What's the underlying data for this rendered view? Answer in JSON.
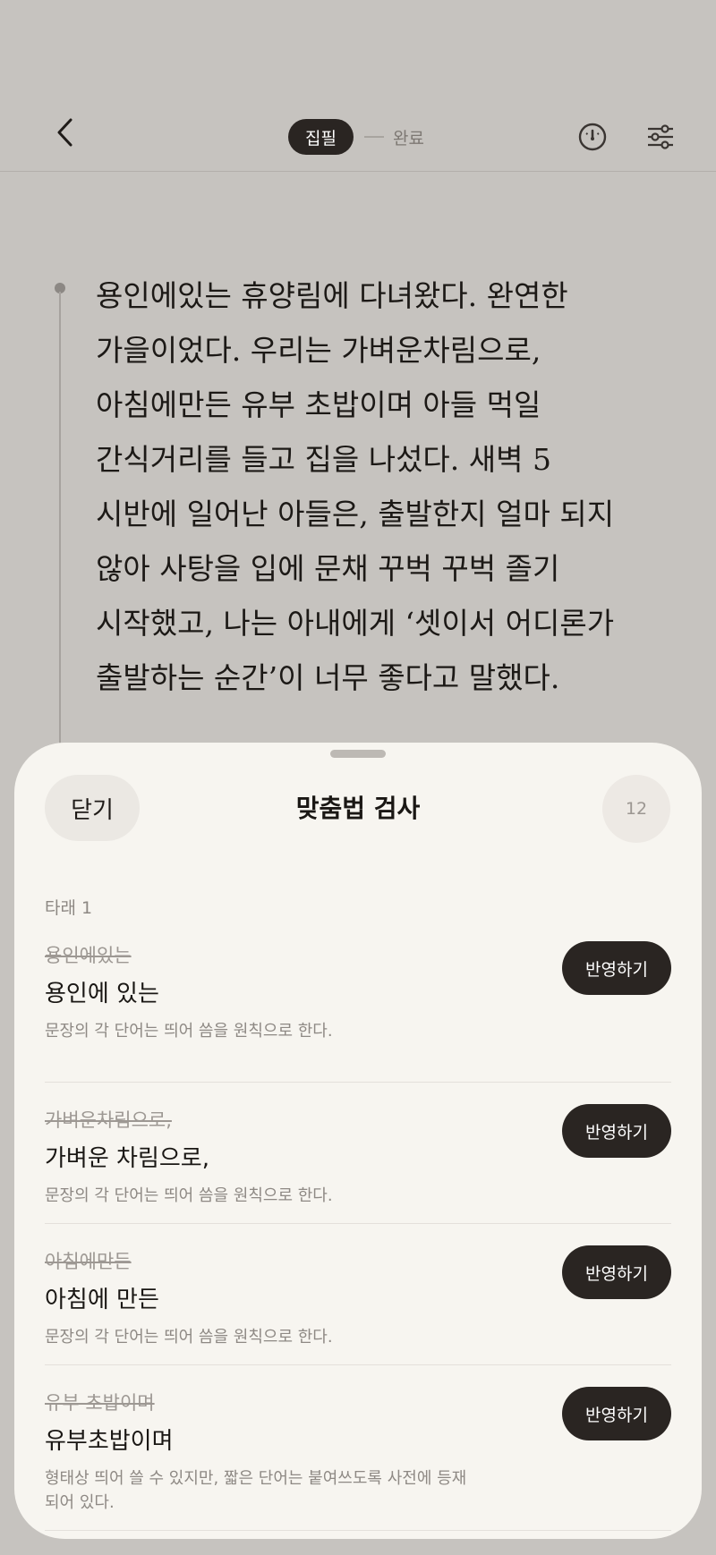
{
  "header": {
    "step_active": "집필",
    "step_next": "완료",
    "icons": {
      "back": "chevron-left-icon",
      "gauge": "gauge-icon",
      "settings": "sliders-icon"
    }
  },
  "editor": {
    "lines": [
      "용인에있는 휴양림에 다녀왔다. 완연한",
      "가을이었다. 우리는 가벼운차림으로,",
      "아침에만든 유부 초밥이며 아들 먹일",
      "간식거리를 들고 집을 나섰다. 새벽 5",
      "시반에 일어난 아들은, 출발한지 얼마 되지",
      "않아 사탕을 입에 문채 꾸벅 꾸벅 졸기",
      "시작했고, 나는 아내에게 ‘셋이서 어디론가",
      "출발하는 순간’이 너무 좋다고 말했다."
    ]
  },
  "sheet": {
    "close_label": "닫기",
    "title": "맞춤법 검사",
    "count": "12",
    "section_label": "타래 1",
    "apply_label": "반영하기",
    "items": [
      {
        "original": "용인에있는",
        "suggestion": "용인에 있는",
        "note": "문장의 각 단어는 띄어 씀을 원칙으로 한다."
      },
      {
        "original": "가벼운차림으로,",
        "suggestion": "가벼운 차림으로,",
        "note": "문장의 각 단어는 띄어 씀을 원칙으로 한다."
      },
      {
        "original": "아침에만든",
        "suggestion": "아침에 만든",
        "note": "문장의 각 단어는 띄어 씀을 원칙으로 한다."
      },
      {
        "original": "유부 초밥이며",
        "suggestion": "유부초밥이며",
        "note": "형태상 띄어 쓸 수 있지만, 짧은 단어는 붙여쓰도록 사전에 등재되어 있다."
      }
    ]
  },
  "colors": {
    "background": "#c6c3bf",
    "sheet": "#f7f5f0",
    "primary_button": "#2a2522"
  }
}
